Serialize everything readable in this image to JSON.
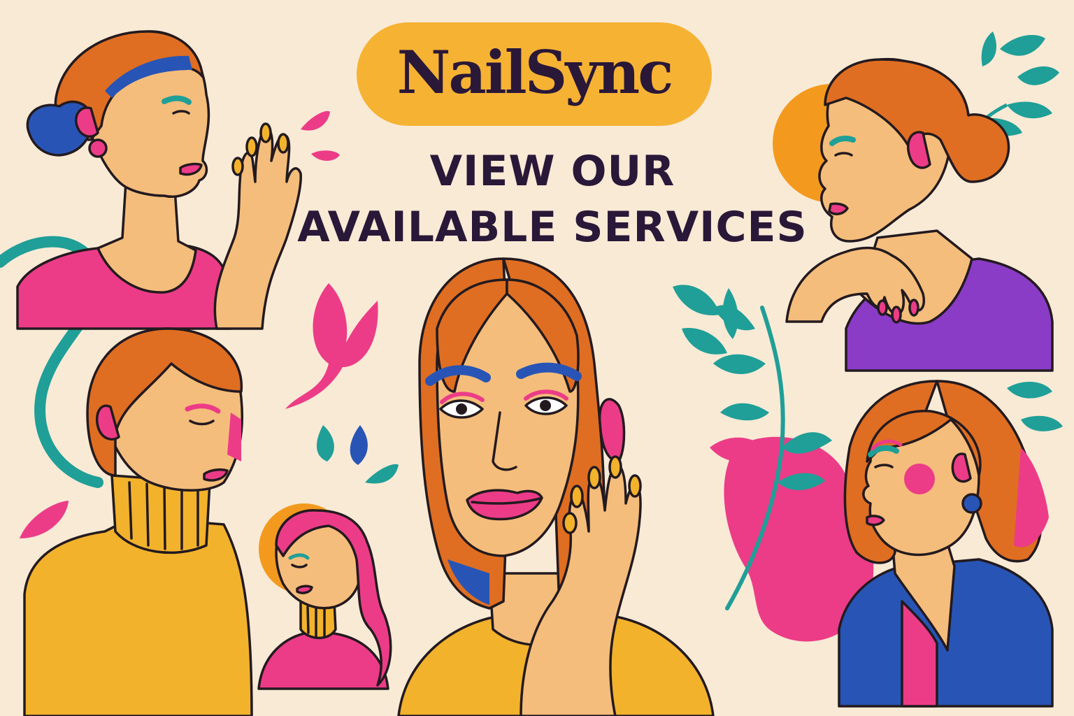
{
  "brand": {
    "name": "NailSync"
  },
  "headline": {
    "line1": "VIEW OUR",
    "line2": "AVAILABLE SERVICES"
  },
  "colors": {
    "background": "#f9ead6",
    "brand_pill": "#f6b233",
    "text_dark": "#2a1838",
    "skin": "#f5bd7b",
    "hair": "#df6e22",
    "pink": "#ec3c87",
    "teal": "#1f9f97",
    "blue": "#2855b5",
    "yellow": "#f2b22c",
    "purple": "#8a3cc6",
    "orange": "#f39a1e",
    "outline": "#231a1f"
  },
  "illustrations": [
    "woman-bun-pink-top-hand-raised",
    "woman-turtleneck-eyes-closed",
    "small-woman-pink-hair-turtleneck",
    "woman-center-hand-on-cheek",
    "woman-profile-purple-top",
    "woman-wavy-hair-blue-cardigan"
  ]
}
